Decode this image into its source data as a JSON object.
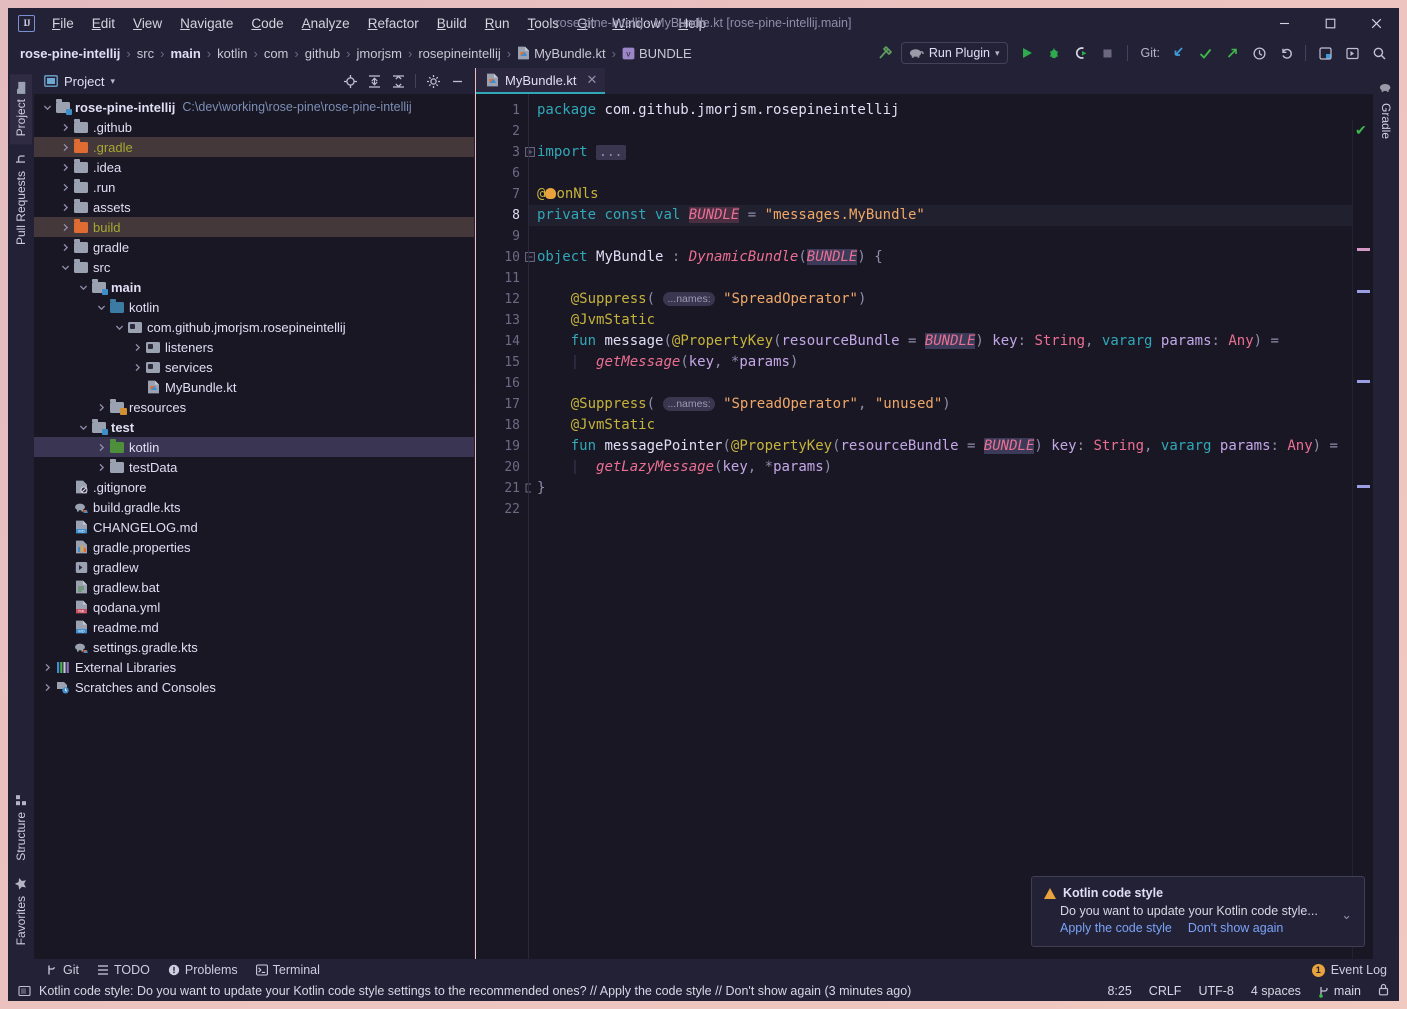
{
  "window": {
    "title": "rose-pine-intellij - MyBundle.kt [rose-pine-intellij.main]",
    "minimize": "—",
    "maximize": "□",
    "close": "✕"
  },
  "menubar": {
    "items": [
      "File",
      "Edit",
      "View",
      "Navigate",
      "Code",
      "Analyze",
      "Refactor",
      "Build",
      "Run",
      "Tools",
      "Git",
      "Window",
      "Help"
    ]
  },
  "breadcrumb": {
    "items": [
      {
        "label": "rose-pine-intellij",
        "bold": true,
        "icon": ""
      },
      {
        "label": "src",
        "bold": false,
        "icon": ""
      },
      {
        "label": "main",
        "bold": true,
        "icon": ""
      },
      {
        "label": "kotlin",
        "bold": false,
        "icon": ""
      },
      {
        "label": "com",
        "bold": false,
        "icon": ""
      },
      {
        "label": "github",
        "bold": false,
        "icon": ""
      },
      {
        "label": "jmorjsm",
        "bold": false,
        "icon": ""
      },
      {
        "label": "rosepineintellij",
        "bold": false,
        "icon": ""
      },
      {
        "label": "MyBundle.kt",
        "bold": false,
        "icon": "kotlin-file-icon"
      },
      {
        "label": "BUNDLE",
        "bold": false,
        "icon": "variable-icon"
      }
    ],
    "separator": "›"
  },
  "toolbar": {
    "build_label": "build-hammer-icon",
    "run_config": "Run Plugin",
    "run_config_chevron": "▾",
    "run": "run-icon",
    "debug": "debug-icon",
    "run_coverage": "run-with-coverage-icon",
    "stop": "stop-icon",
    "git_label": "Git:",
    "update_project": "update-project-icon",
    "commit": "commit-icon",
    "push": "push-icon",
    "history": "history-icon",
    "rollback": "rollback-icon",
    "settings": "settings-icon",
    "select_in": "select-in-icon",
    "search": "search-icon"
  },
  "left_strip": {
    "top": [
      {
        "label": "Project",
        "icon": "project-icon",
        "active": true
      },
      {
        "label": "Pull Requests",
        "icon": "pull-request-icon",
        "active": false
      }
    ],
    "bottom": [
      {
        "label": "Structure",
        "icon": "structure-icon",
        "active": false
      },
      {
        "label": "Favorites",
        "icon": "star-icon",
        "active": false
      }
    ]
  },
  "right_strip": {
    "items": [
      {
        "label": "Gradle",
        "icon": "gradle-elephant-icon"
      }
    ]
  },
  "project_panel": {
    "title": "Project",
    "title_chevron": "▾",
    "tools": [
      "locate-icon",
      "expand-all-icon",
      "collapse-all-icon",
      "gear-icon",
      "hide-icon"
    ],
    "tree": [
      {
        "depth": 0,
        "arrow": "v",
        "icon": "folder-module",
        "label": "rose-pine-intellij",
        "bold": true,
        "path": "C:\\dev\\working\\rose-pine\\rose-pine-intellij",
        "sel": ""
      },
      {
        "depth": 1,
        "arrow": ">",
        "icon": "folder",
        "label": ".github",
        "bold": false,
        "path": "",
        "sel": ""
      },
      {
        "depth": 1,
        "arrow": ">",
        "icon": "folder-orange",
        "label": ".gradle",
        "bold": false,
        "path": "",
        "sel": "orange",
        "olive": true
      },
      {
        "depth": 1,
        "arrow": ">",
        "icon": "folder",
        "label": ".idea",
        "bold": false,
        "path": "",
        "sel": ""
      },
      {
        "depth": 1,
        "arrow": ">",
        "icon": "folder",
        "label": ".run",
        "bold": false,
        "path": "",
        "sel": ""
      },
      {
        "depth": 1,
        "arrow": ">",
        "icon": "folder",
        "label": "assets",
        "bold": false,
        "path": "",
        "sel": ""
      },
      {
        "depth": 1,
        "arrow": ">",
        "icon": "folder-orange",
        "label": "build",
        "bold": false,
        "path": "",
        "sel": "orange",
        "olive": true
      },
      {
        "depth": 1,
        "arrow": ">",
        "icon": "folder",
        "label": "gradle",
        "bold": false,
        "path": "",
        "sel": ""
      },
      {
        "depth": 1,
        "arrow": "v",
        "icon": "folder",
        "label": "src",
        "bold": false,
        "path": "",
        "sel": ""
      },
      {
        "depth": 2,
        "arrow": "v",
        "icon": "folder-module",
        "label": "main",
        "bold": true,
        "path": "",
        "sel": ""
      },
      {
        "depth": 3,
        "arrow": "v",
        "icon": "folder-source",
        "label": "kotlin",
        "bold": false,
        "path": "",
        "sel": ""
      },
      {
        "depth": 4,
        "arrow": "v",
        "icon": "package",
        "label": "com.github.jmorjsm.rosepineintellij",
        "bold": false,
        "path": "",
        "sel": ""
      },
      {
        "depth": 5,
        "arrow": ">",
        "icon": "package",
        "label": "listeners",
        "bold": false,
        "path": "",
        "sel": ""
      },
      {
        "depth": 5,
        "arrow": ">",
        "icon": "package",
        "label": "services",
        "bold": false,
        "path": "",
        "sel": ""
      },
      {
        "depth": 5,
        "arrow": "",
        "icon": "kotlin-file",
        "label": "MyBundle.kt",
        "bold": false,
        "path": "",
        "sel": ""
      },
      {
        "depth": 3,
        "arrow": ">",
        "icon": "folder-resource",
        "label": "resources",
        "bold": false,
        "path": "",
        "sel": ""
      },
      {
        "depth": 2,
        "arrow": "v",
        "icon": "folder-module",
        "label": "test",
        "bold": true,
        "path": "",
        "sel": ""
      },
      {
        "depth": 3,
        "arrow": ">",
        "icon": "folder-test",
        "label": "kotlin",
        "bold": false,
        "path": "",
        "sel": "blue"
      },
      {
        "depth": 3,
        "arrow": ">",
        "icon": "folder",
        "label": "testData",
        "bold": false,
        "path": "",
        "sel": ""
      },
      {
        "depth": 1,
        "arrow": "",
        "icon": "gitignore-file",
        "label": ".gitignore",
        "bold": false,
        "path": "",
        "sel": ""
      },
      {
        "depth": 1,
        "arrow": "",
        "icon": "gradle-file",
        "label": "build.gradle.kts",
        "bold": false,
        "path": "",
        "sel": ""
      },
      {
        "depth": 1,
        "arrow": "",
        "icon": "md-file",
        "label": "CHANGELOG.md",
        "bold": false,
        "path": "",
        "sel": ""
      },
      {
        "depth": 1,
        "arrow": "",
        "icon": "properties-file",
        "label": "gradle.properties",
        "bold": false,
        "path": "",
        "sel": ""
      },
      {
        "depth": 1,
        "arrow": "",
        "icon": "script-file",
        "label": "gradlew",
        "bold": false,
        "path": "",
        "sel": ""
      },
      {
        "depth": 1,
        "arrow": "",
        "icon": "bat-file",
        "label": "gradlew.bat",
        "bold": false,
        "path": "",
        "sel": ""
      },
      {
        "depth": 1,
        "arrow": "",
        "icon": "yml-file",
        "label": "qodana.yml",
        "bold": false,
        "path": "",
        "sel": ""
      },
      {
        "depth": 1,
        "arrow": "",
        "icon": "md-file",
        "label": "readme.md",
        "bold": false,
        "path": "",
        "sel": ""
      },
      {
        "depth": 1,
        "arrow": "",
        "icon": "gradle-file",
        "label": "settings.gradle.kts",
        "bold": false,
        "path": "",
        "sel": ""
      },
      {
        "depth": 0,
        "arrow": ">",
        "icon": "libraries",
        "label": "External Libraries",
        "bold": false,
        "path": "",
        "sel": ""
      },
      {
        "depth": 0,
        "arrow": ">",
        "icon": "scratches",
        "label": "Scratches and Consoles",
        "bold": false,
        "path": "",
        "sel": ""
      }
    ]
  },
  "editor": {
    "tab": {
      "label": "MyBundle.kt",
      "icon": "kotlin-file-icon",
      "close": "✕"
    },
    "current_line": 8,
    "inspection_status": "✔",
    "lines": [
      {
        "n": 1,
        "fold": "",
        "text": "package com.github.jmorjsm.rosepineintellij"
      },
      {
        "n": 2,
        "fold": "",
        "text": ""
      },
      {
        "n": 3,
        "fold": "+",
        "text": "import ..."
      },
      {
        "n": 6,
        "fold": "",
        "text": ""
      },
      {
        "n": 7,
        "fold": "",
        "text": "@NonNls"
      },
      {
        "n": 8,
        "fold": "",
        "text": "private const val BUNDLE = \"messages.MyBundle\""
      },
      {
        "n": 9,
        "fold": "",
        "text": ""
      },
      {
        "n": 10,
        "fold": "-",
        "text": "object MyBundle : DynamicBundle(BUNDLE) {"
      },
      {
        "n": 11,
        "fold": "",
        "text": ""
      },
      {
        "n": 12,
        "fold": "",
        "text": "    @Suppress( ...names: \"SpreadOperator\")"
      },
      {
        "n": 13,
        "fold": "",
        "text": "    @JvmStatic"
      },
      {
        "n": 14,
        "fold": "",
        "text": "    fun message(@PropertyKey(resourceBundle = BUNDLE) key: String, vararg params: Any) ="
      },
      {
        "n": 15,
        "fold": "",
        "text": "        getMessage(key, *params)"
      },
      {
        "n": 16,
        "fold": "",
        "text": ""
      },
      {
        "n": 17,
        "fold": "",
        "text": "    @Suppress( ...names: \"SpreadOperator\", \"unused\")"
      },
      {
        "n": 18,
        "fold": "",
        "text": "    @JvmStatic"
      },
      {
        "n": 19,
        "fold": "",
        "text": "    fun messagePointer(@PropertyKey(resourceBundle = BUNDLE) key: String, vararg params: Any) ="
      },
      {
        "n": 20,
        "fold": "",
        "text": "        getLazyMessage(key, *params)"
      },
      {
        "n": 21,
        "fold": "-",
        "text": "}"
      },
      {
        "n": 22,
        "fold": "",
        "text": ""
      }
    ],
    "hint_label": "...names:"
  },
  "notification": {
    "title": "Kotlin code style",
    "icon": "warning-icon",
    "body": "Do you want to update your Kotlin code style...",
    "actions": [
      "Apply the code style",
      "Don't show again"
    ],
    "chevron": "⌄"
  },
  "bottom_bar": {
    "tabs": [
      {
        "label": "Git",
        "icon": "git-branch-icon"
      },
      {
        "label": "TODO",
        "icon": "todo-icon"
      },
      {
        "label": "Problems",
        "icon": "problems-icon"
      },
      {
        "label": "Terminal",
        "icon": "terminal-icon"
      }
    ],
    "event_log": {
      "label": "Event Log",
      "count": "1"
    }
  },
  "status_bar": {
    "icon": "message-icon",
    "message": "Kotlin code style: Do you want to update your Kotlin code style settings to the recommended ones? // Apply the code style // Don't show again (3 minutes ago)",
    "caret": "8:25",
    "line_separator": "CRLF",
    "encoding": "UTF-8",
    "indent": "4 spaces",
    "branch": "main",
    "lock": "lock-icon"
  },
  "colors": {
    "bg": "#191724",
    "panel": "#232136",
    "accent": "#31a8b8",
    "selection_orange": "#45383a",
    "selection_blue": "#393552",
    "link": "#7aa2f7",
    "warning": "#e8a33d",
    "green": "#4f9e4f"
  }
}
